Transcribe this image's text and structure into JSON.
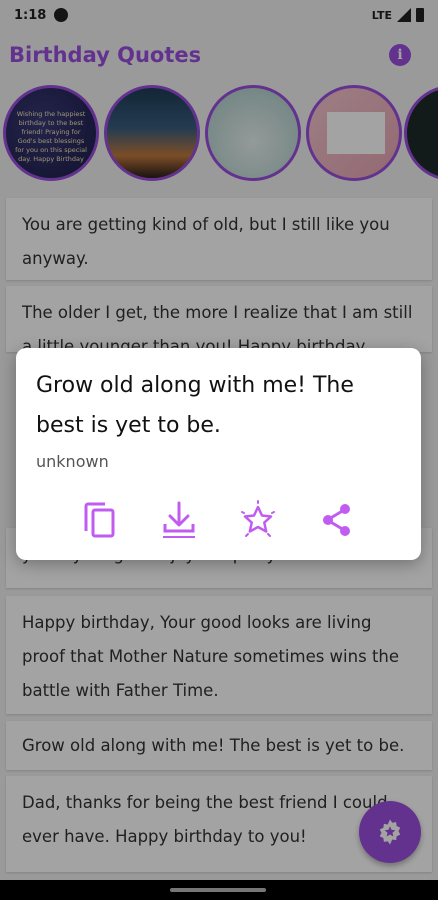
{
  "status_bar": {
    "time": "1:18",
    "network": "LTE",
    "icons": [
      "notification-icon",
      "signal-icon",
      "battery-icon"
    ]
  },
  "app_bar": {
    "title": "Birthday Quotes",
    "info_icon": "info-icon",
    "info_glyph": "i"
  },
  "stories": [
    {
      "text": "Wishing the happiest birthday to the best friend! Praying for God's best blessings for you on this special day. Happy Birthday"
    },
    {
      "text": ""
    },
    {
      "text": ""
    },
    {
      "text": ""
    },
    {
      "text": ""
    }
  ],
  "quotes": [
    "You are getting kind of old, but I still like you anyway.",
    "The older I get, the more I realize that I am still a little younger than you! Happy birthday.",
    "years younger. Enjoy the party!",
    "Happy birthday, Your good looks are living proof that Mother Nature sometimes wins the battle with Father Time.",
    "Grow old along with me! The best is yet to be.",
    "Dad, thanks for being the best friend I could ever have. Happy birthday to you!"
  ],
  "dialog": {
    "quote": "Grow old along with me! The best is yet to be.",
    "author": "unknown",
    "actions": [
      "copy-icon",
      "download-icon",
      "favorite-icon",
      "share-icon"
    ]
  },
  "fab": {
    "icon": "favorites-star-icon"
  },
  "colors": {
    "accent": "#9b4fe0",
    "action_icon": "#c15cf0",
    "scrim": "rgba(0,0,0,0.36)"
  }
}
